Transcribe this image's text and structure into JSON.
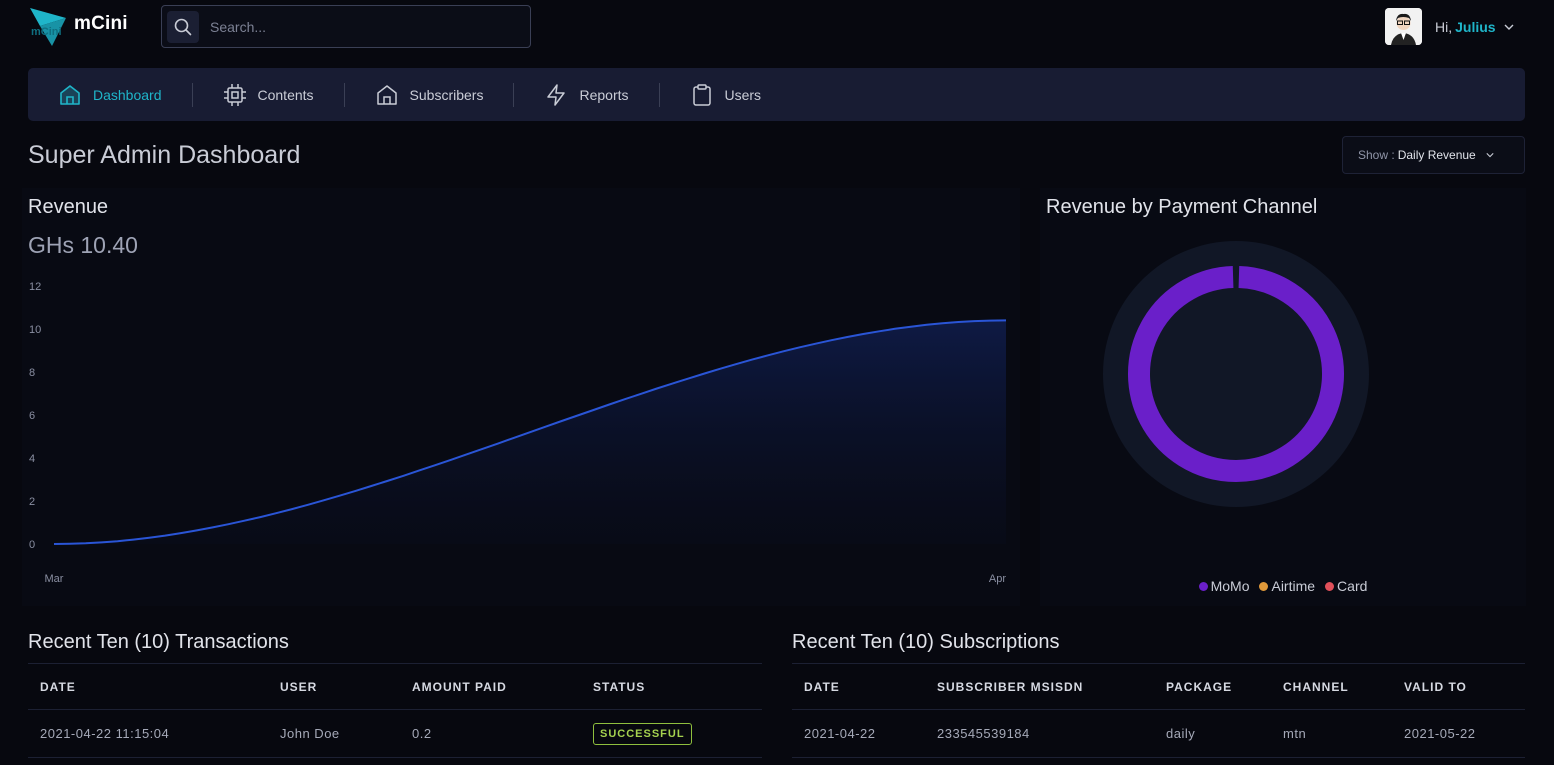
{
  "app": {
    "name": "mCini"
  },
  "search": {
    "placeholder": "Search..."
  },
  "user": {
    "greeting": "Hi,",
    "name": "Julius"
  },
  "nav": {
    "items": [
      {
        "label": "Dashboard",
        "icon": "home-icon",
        "active": true
      },
      {
        "label": "Contents",
        "icon": "chip-icon",
        "active": false
      },
      {
        "label": "Subscribers",
        "icon": "home-icon",
        "active": false
      },
      {
        "label": "Reports",
        "icon": "lightning-icon",
        "active": false
      },
      {
        "label": "Users",
        "icon": "clipboard-icon",
        "active": false
      }
    ]
  },
  "page": {
    "title": "Super Admin Dashboard"
  },
  "show_select": {
    "label": "Show :",
    "value": "Daily Revenue"
  },
  "revenue": {
    "title": "Revenue",
    "total": "GHs 10.40"
  },
  "channel": {
    "title": "Revenue by Payment Channel",
    "legend": [
      {
        "name": "MoMo",
        "color": "#6a1fc9"
      },
      {
        "name": "Airtime",
        "color": "#e0993a"
      },
      {
        "name": "Card",
        "color": "#e0505a"
      }
    ]
  },
  "transactions": {
    "title": "Recent Ten (10) Transactions",
    "columns": [
      "DATE",
      "USER",
      "AMOUNT PAID",
      "STATUS"
    ],
    "rows": [
      {
        "date": "2021-04-22 11:15:04",
        "user": "John Doe",
        "amount": "0.2",
        "status": "SUCCESSFUL"
      }
    ]
  },
  "subscriptions": {
    "title": "Recent Ten (10) Subscriptions",
    "columns": [
      "DATE",
      "SUBSCRIBER MSISDN",
      "PACKAGE",
      "CHANNEL",
      "VALID TO"
    ],
    "rows": [
      {
        "date": "2021-04-22",
        "msisdn": "233545539184",
        "package": "daily",
        "channel": "mtn",
        "valid_to": "2021-05-22"
      }
    ]
  },
  "chart_data": [
    {
      "type": "area",
      "title": "Revenue",
      "x": [
        "Mar",
        "Apr"
      ],
      "series": [
        {
          "values": [
            0,
            10.4
          ]
        }
      ],
      "ylim": [
        0,
        12
      ],
      "yticks": [
        0,
        2,
        4,
        6,
        8,
        10,
        12
      ],
      "grid": false,
      "color": "#2a55d6"
    },
    {
      "type": "pie",
      "title": "Revenue by Payment Channel",
      "categories": [
        "MoMo",
        "Airtime",
        "Card"
      ],
      "values": [
        10.4,
        0,
        0
      ],
      "colors": [
        "#6a1fc9",
        "#e0993a",
        "#e0505a"
      ],
      "legend": "bottom"
    }
  ]
}
